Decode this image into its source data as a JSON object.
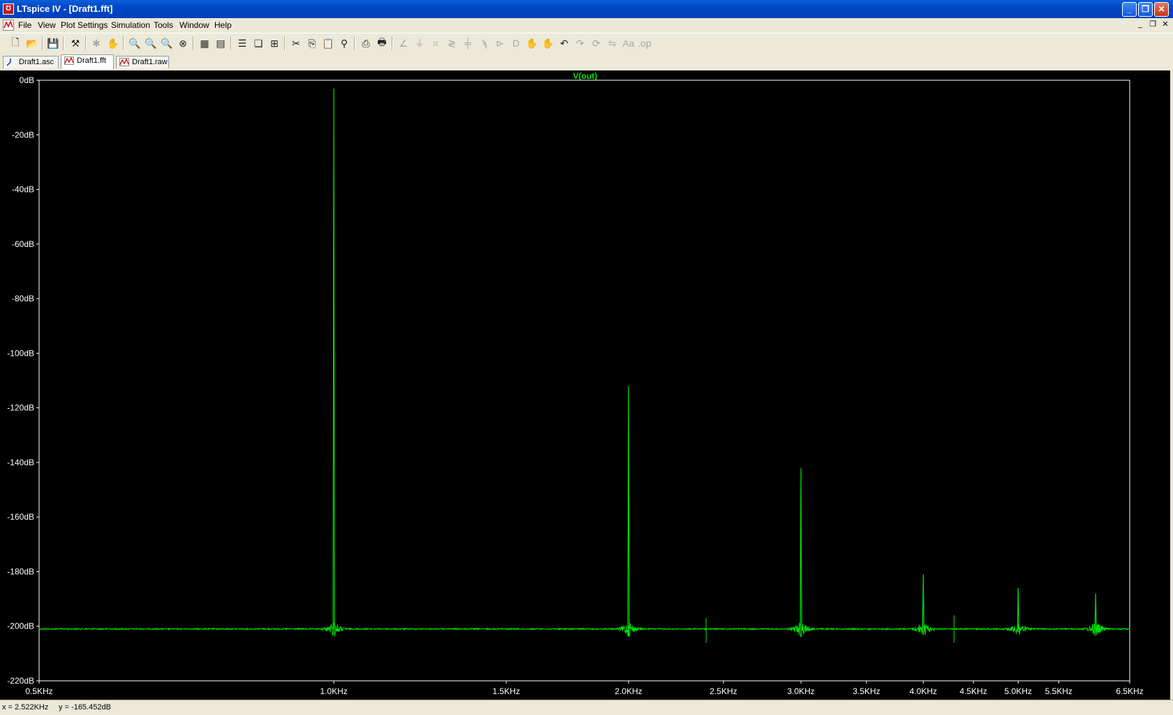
{
  "window": {
    "title": "LTspice IV - [Draft1.fft]",
    "controls": [
      "minimize-icon",
      "restore-icon",
      "close-icon"
    ]
  },
  "menu": {
    "items": [
      "File",
      "View",
      "Plot Settings",
      "Simulation",
      "Tools",
      "Window",
      "Help"
    ]
  },
  "toolbar": {
    "icons": [
      "new-schematic-icon",
      "open-icon",
      "save-icon",
      "control-panel-icon",
      "run-icon",
      "halt-icon",
      "zoom-in-icon",
      "zoom-area-icon",
      "zoom-out-icon",
      "zoom-cancel-icon",
      "autorange-icon",
      "add-trace-icon",
      "tile-horizontal-icon",
      "cascade-icon",
      "tile-icon",
      "cut-icon",
      "copy-icon",
      "paste-icon",
      "find-icon",
      "print-preview-icon",
      "print-icon",
      "wire-icon",
      "ground-icon",
      "label-icon",
      "resistor-icon",
      "capacitor-icon",
      "inductor-icon",
      "diode-icon",
      "component-icon",
      "move-icon",
      "drag-icon",
      "undo-icon",
      "redo-icon",
      "rotate-icon",
      "mirror-icon",
      "text-icon",
      "spice-directive-icon"
    ]
  },
  "tabs": [
    {
      "label": "Draft1.asc",
      "active": false
    },
    {
      "label": "Draft1.fft",
      "active": true
    },
    {
      "label": "Draft1.raw",
      "active": false
    }
  ],
  "colors": {
    "trace": "#00e000",
    "grid": "#ffffff",
    "background": "#000000",
    "label": "#ffffff"
  },
  "chart_data": {
    "type": "line",
    "title": "V(out)",
    "xlabel": "",
    "ylabel": "",
    "x_scale": "log",
    "xlim": [
      500,
      6500
    ],
    "ylim": [
      -220,
      0
    ],
    "x_ticks": [
      {
        "value": 500,
        "label": "0.5KHz"
      },
      {
        "value": 1000,
        "label": "1.0KHz"
      },
      {
        "value": 1500,
        "label": "1.5KHz"
      },
      {
        "value": 2000,
        "label": "2.0KHz"
      },
      {
        "value": 2500,
        "label": "2.5KHz"
      },
      {
        "value": 3000,
        "label": "3.0KHz"
      },
      {
        "value": 3500,
        "label": "3.5KHz"
      },
      {
        "value": 4000,
        "label": "4.0KHz"
      },
      {
        "value": 4500,
        "label": "4.5KHz"
      },
      {
        "value": 5000,
        "label": "5.0KHz"
      },
      {
        "value": 5500,
        "label": "5.5KHz"
      },
      {
        "value": 6500,
        "label": "6.5KHz"
      }
    ],
    "y_ticks": [
      {
        "value": 0,
        "label": "0dB"
      },
      {
        "value": -20,
        "label": "-20dB"
      },
      {
        "value": -40,
        "label": "-40dB"
      },
      {
        "value": -60,
        "label": "-60dB"
      },
      {
        "value": -80,
        "label": "-80dB"
      },
      {
        "value": -100,
        "label": "-100dB"
      },
      {
        "value": -120,
        "label": "-120dB"
      },
      {
        "value": -140,
        "label": "-140dB"
      },
      {
        "value": -160,
        "label": "-160dB"
      },
      {
        "value": -180,
        "label": "-180dB"
      },
      {
        "value": -200,
        "label": "-200dB"
      },
      {
        "value": -220,
        "label": "-220dB"
      }
    ],
    "series": [
      {
        "name": "V(out)",
        "noise_floor_db": -201,
        "peaks": [
          {
            "freq": 1000,
            "db": -3
          },
          {
            "freq": 2000,
            "db": -112
          },
          {
            "freq": 3000,
            "db": -142
          },
          {
            "freq": 4000,
            "db": -181
          },
          {
            "freq": 5000,
            "db": -186
          },
          {
            "freq": 6000,
            "db": -188
          }
        ],
        "minor_spikes": [
          {
            "freq": 2400,
            "db": -197
          },
          {
            "freq": 4300,
            "db": -196
          }
        ]
      }
    ],
    "grid": false,
    "axis_box": true
  },
  "status": {
    "x_readout": "x = 2.522KHz",
    "y_readout": "y = -165.452dB"
  }
}
